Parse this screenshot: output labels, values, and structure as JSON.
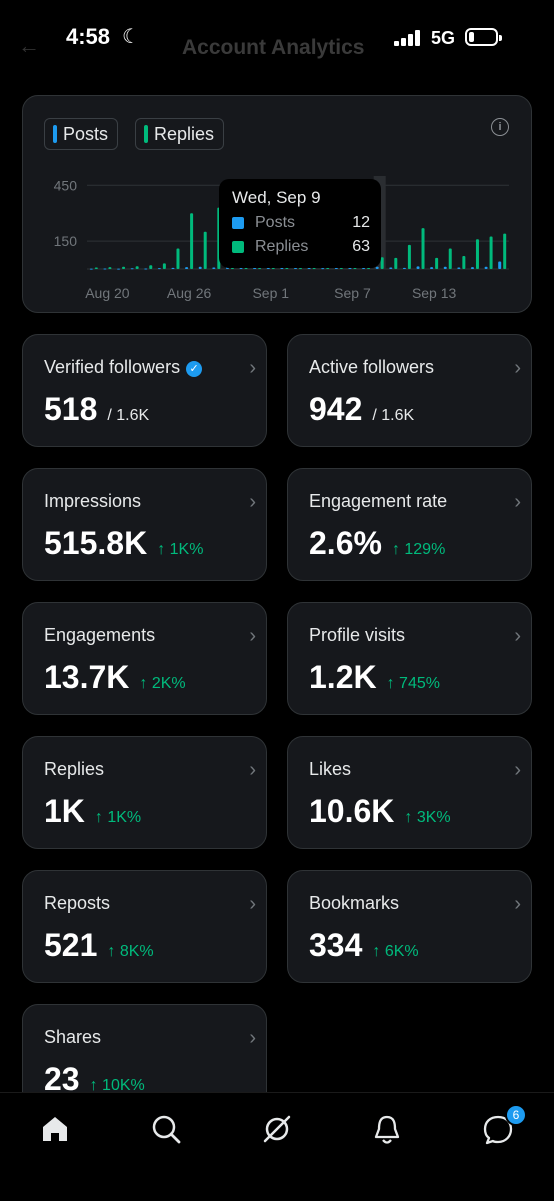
{
  "status_bar": {
    "time": "4:58",
    "network": "5G",
    "obscured_title": "Account Analytics"
  },
  "chart": {
    "legend": [
      {
        "label": "Posts",
        "color": "#1d9bf0"
      },
      {
        "label": "Replies",
        "color": "#00ba7c"
      }
    ],
    "tooltip": {
      "date": "Wed, Sep 9",
      "rows": [
        {
          "label": "Posts",
          "value": "12"
        },
        {
          "label": "Replies",
          "value": "63"
        }
      ]
    }
  },
  "chart_data": {
    "type": "bar",
    "y_tick_labels": [
      "450",
      "150"
    ],
    "x_tick_labels": [
      "Aug 20",
      "Aug 26",
      "Sep 1",
      "Sep 7",
      "Sep 13"
    ],
    "categories": [
      "Aug 19",
      "Aug 20",
      "Aug 21",
      "Aug 22",
      "Aug 23",
      "Aug 24",
      "Aug 25",
      "Aug 26",
      "Aug 27",
      "Aug 28",
      "Aug 29",
      "Aug 30",
      "Aug 31",
      "Sep 1",
      "Sep 2",
      "Sep 3",
      "Sep 4",
      "Sep 5",
      "Sep 6",
      "Sep 7",
      "Sep 8",
      "Sep 9",
      "Sep 10",
      "Sep 11",
      "Sep 12",
      "Sep 13",
      "Sep 14",
      "Sep 15",
      "Sep 16",
      "Sep 17",
      "Sep 18"
    ],
    "ylim": [
      0,
      500
    ],
    "highlight": "Sep 9",
    "series": [
      {
        "name": "Posts",
        "color": "#1d9bf0",
        "values": [
          2,
          3,
          2,
          4,
          3,
          5,
          6,
          10,
          12,
          8,
          20,
          15,
          10,
          8,
          6,
          12,
          8,
          5,
          6,
          10,
          15,
          12,
          8,
          6,
          14,
          10,
          12,
          8,
          10,
          12,
          40
        ]
      },
      {
        "name": "Replies",
        "color": "#00ba7c",
        "values": [
          8,
          10,
          12,
          15,
          20,
          30,
          110,
          300,
          200,
          330,
          90,
          140,
          35,
          40,
          30,
          60,
          45,
          30,
          70,
          50,
          20,
          63,
          60,
          130,
          220,
          60,
          110,
          70,
          160,
          175,
          190
        ]
      }
    ],
    "grid": true
  },
  "metrics": [
    {
      "title": "Verified followers",
      "value": "518",
      "sub": "/ 1.6K",
      "verified": true
    },
    {
      "title": "Active followers",
      "value": "942",
      "sub": "/ 1.6K"
    },
    {
      "title": "Impressions",
      "value": "515.8K",
      "delta": "↑ 1K%"
    },
    {
      "title": "Engagement rate",
      "value": "2.6%",
      "delta": "↑ 129%"
    },
    {
      "title": "Engagements",
      "value": "13.7K",
      "delta": "↑ 2K%"
    },
    {
      "title": "Profile visits",
      "value": "1.2K",
      "delta": "↑ 745%"
    },
    {
      "title": "Replies",
      "value": "1K",
      "delta": "↑ 1K%"
    },
    {
      "title": "Likes",
      "value": "10.6K",
      "delta": "↑ 3K%"
    },
    {
      "title": "Reposts",
      "value": "521",
      "delta": "↑ 8K%"
    },
    {
      "title": "Bookmarks",
      "value": "334",
      "delta": "↑ 6K%"
    },
    {
      "title": "Shares",
      "value": "23",
      "delta": "↑ 10K%"
    }
  ],
  "nav": {
    "items": [
      "home-icon",
      "search-icon",
      "grok-icon",
      "notifications-icon",
      "messages-icon"
    ],
    "messages_badge": "6"
  }
}
